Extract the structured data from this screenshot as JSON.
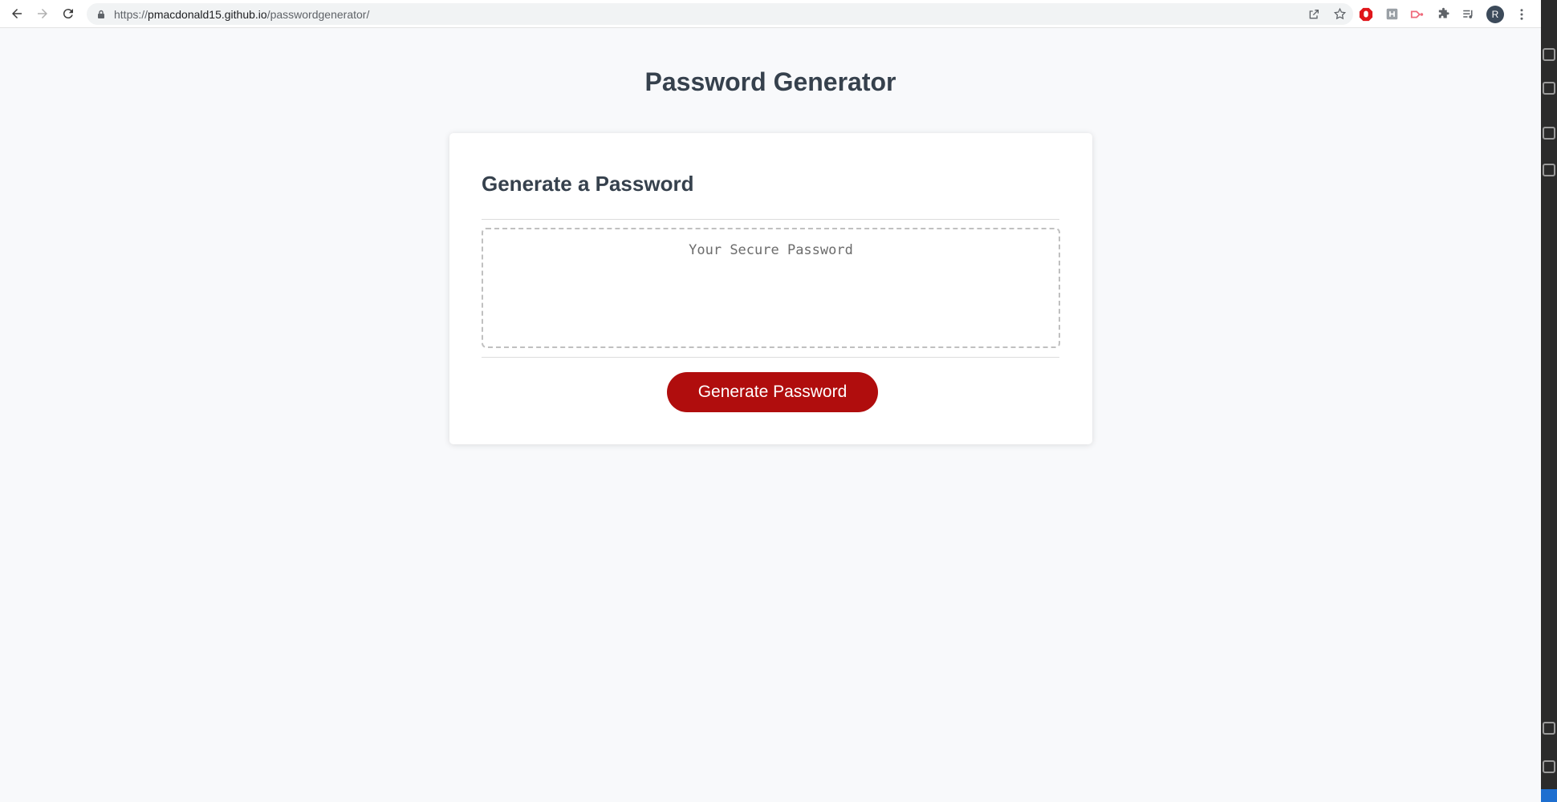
{
  "browser": {
    "url_scheme": "https://",
    "url_host": "pmacdonald15.github.io",
    "url_path": "/passwordgenerator/",
    "avatar_letter": "R"
  },
  "page": {
    "title": "Password Generator"
  },
  "card": {
    "header": "Generate a Password",
    "password_placeholder": "Your Secure Password",
    "password_value": "",
    "generate_button_label": "Generate Password"
  },
  "colors": {
    "button": "#b00d0d",
    "heading": "#36414d",
    "page_background": "#f8f9fb"
  }
}
